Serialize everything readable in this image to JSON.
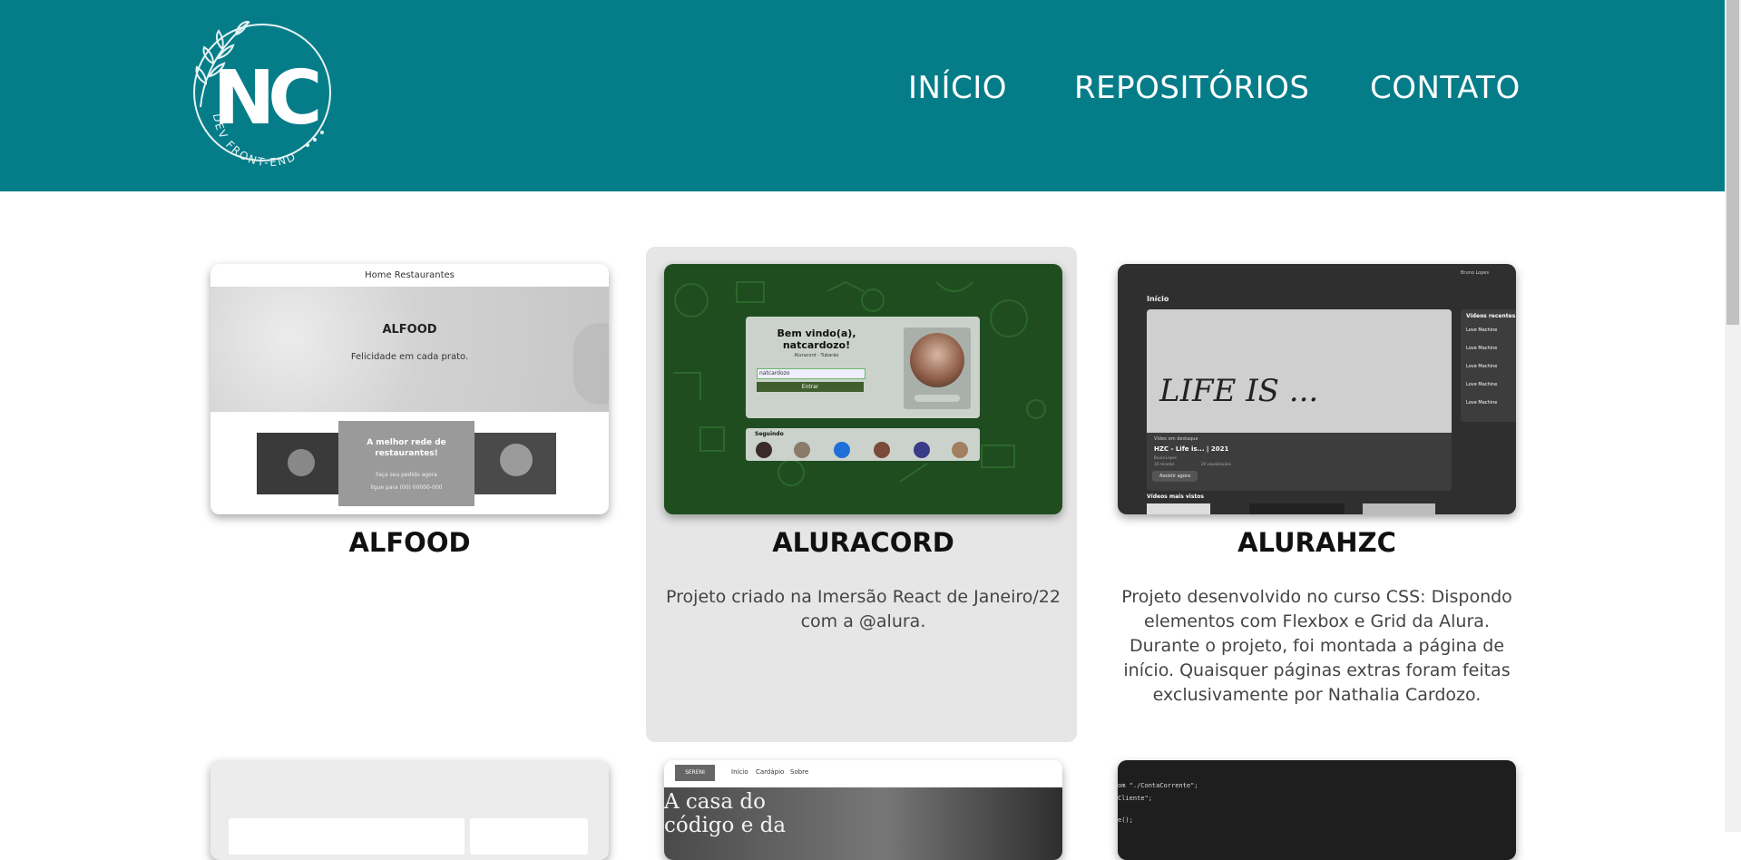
{
  "logo": {
    "initials": "NC",
    "tagline": "DEV FRONT-END"
  },
  "nav": [
    {
      "label": "INÍCIO"
    },
    {
      "label": "REPOSITÓRIOS"
    },
    {
      "label": "CONTATO"
    }
  ],
  "projects": [
    {
      "title": "ALFOOD",
      "description": "",
      "thumb": {
        "nav": "Home  Restaurantes",
        "hero_title": "ALFOOD",
        "hero_sub": "Felicidade em cada prato.",
        "box_title": "A melhor rede de restaurantes!",
        "box_line1": "Faça seu pedido agora",
        "box_line2": "ligue para (00) 00000-000"
      }
    },
    {
      "title": "ALURACORD",
      "description": "Projeto criado na Imersão React de Janeiro/22 com a @alura.",
      "thumb": {
        "welcome": "Bem vindo(a), natcardozo!",
        "subtitle": "Aluracord - Tubarão",
        "input_value": "natcardozo",
        "button": "Entrar",
        "following": "Seguindo"
      }
    },
    {
      "title": "ALURAHZC",
      "description": "Projeto desenvolvido no curso CSS: Dispondo elementos com Flexbox e Grid da Alura. Durante o projeto, foi montada a página de início. Quaisquer páginas extras foram feitas exclusivamente por Nathalia Cardozo.",
      "thumb": {
        "user": "Bruno Lopes",
        "section": "Início",
        "recent": "Vídeos recentes",
        "recent_item": "Love Machine",
        "recent_sub": "Bruno Lopes",
        "hero_text": "LIFE IS ...",
        "featured_label": "Vídeo em destaque",
        "featured_title": "HZC - Life is... | 2021",
        "featured_author": "Bruno Lopes",
        "stats_a": "10 minutos",
        "stats_b": "20 visualizações",
        "watch": "Assistir agora",
        "most_viewed": "Vídeos mais vistos"
      }
    },
    {
      "title": "",
      "description": "",
      "thumb": {}
    },
    {
      "title": "",
      "description": "",
      "thumb": {
        "brand": "SERENI",
        "links": [
          "Início",
          "Cardápio",
          "Sobre"
        ],
        "hero": "A casa do código e da"
      }
    },
    {
      "title": "",
      "description": "",
      "thumb": {
        "code_line1": "om \"./ContaCorrente\";",
        "code_line2": "Cliente\";",
        "code_line3": "e();"
      }
    }
  ],
  "colors": {
    "header_bg": "#057d89",
    "hover_card_bg": "#e6e6e6",
    "text_dark": "#111111",
    "text_desc": "#444444"
  }
}
